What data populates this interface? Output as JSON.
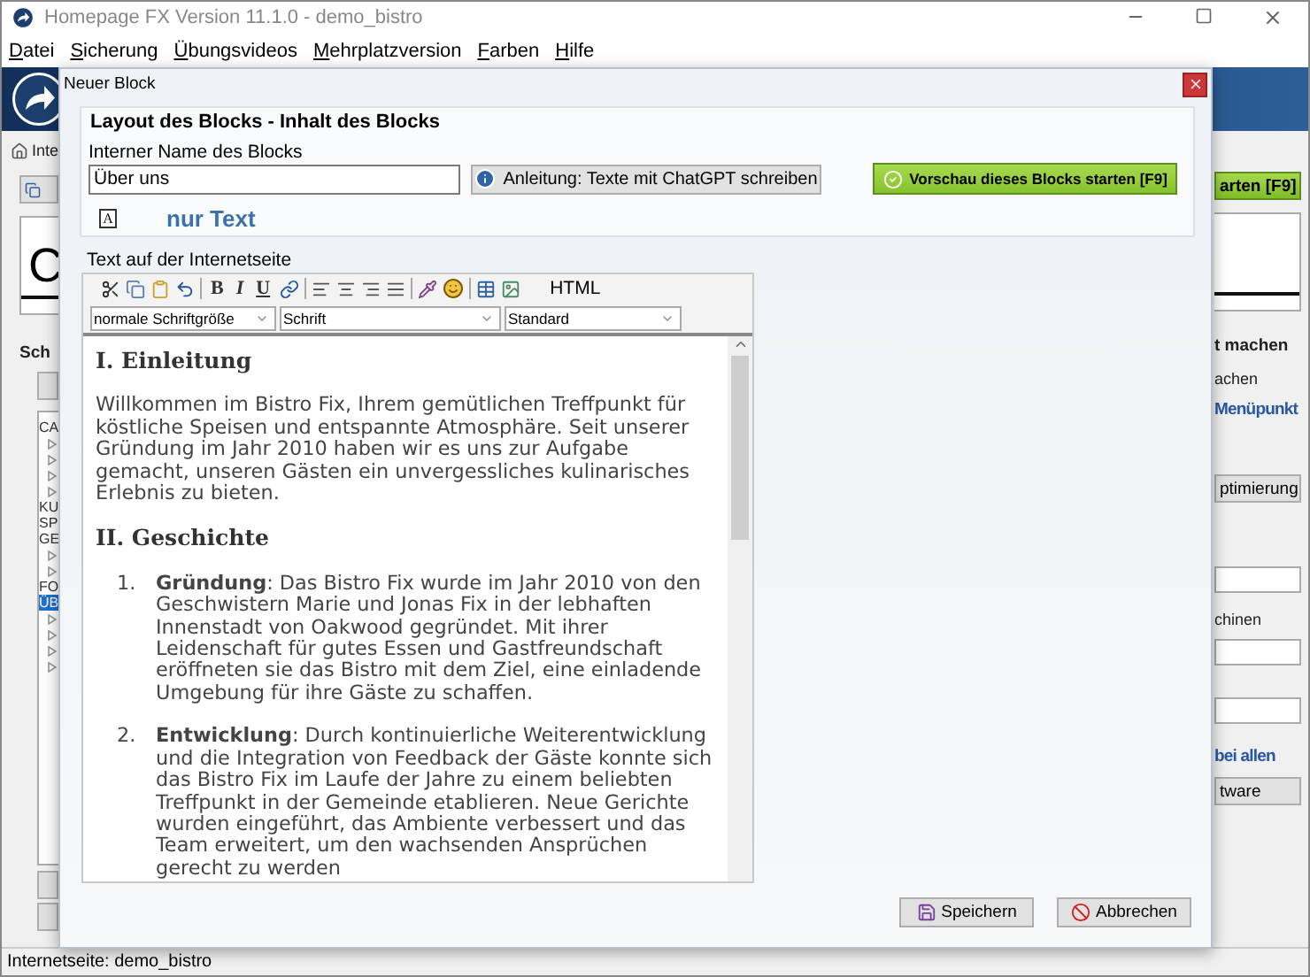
{
  "window": {
    "title": "Homepage FX Version 11.1.0 - demo_bistro"
  },
  "menu": [
    "Datei",
    "Sicherung",
    "Übungsvideos",
    "Mehrplatzversion",
    "Farben",
    "Hilfe"
  ],
  "background": {
    "breadcrumb": "Inte",
    "preview_button": "arten [F9]",
    "title_preview": "C",
    "section_title": "Sch",
    "tree": [
      {
        "label": "CA",
        "selected": false,
        "children": [
          {
            "selected": false
          },
          {
            "selected": false
          },
          {
            "selected": false
          },
          {
            "selected": false
          }
        ]
      },
      {
        "label": "KU",
        "selected": false
      },
      {
        "label": "SP",
        "selected": false
      },
      {
        "label": "GE",
        "selected": false,
        "children": [
          {
            "selected": false
          },
          {
            "selected": false
          }
        ]
      },
      {
        "label": "FO",
        "selected": false
      },
      {
        "label": "ÜB",
        "selected": true,
        "children": [
          {
            "selected": false
          },
          {
            "selected": false
          },
          {
            "selected": false
          },
          {
            "selected": false
          }
        ]
      }
    ],
    "right_panel": {
      "heading": "t machen",
      "text_1": "achen",
      "link_1": "Menüpunkt",
      "button_1": "ptimierung",
      "text_2": "chinen",
      "link_2": "bei allen",
      "button_2": "tware"
    }
  },
  "dialog": {
    "title": "Neuer Block",
    "group_title": "Layout des Blocks - Inhalt des Blocks",
    "name_label": "Interner Name des Blocks",
    "name_value": "Über uns",
    "help_button": "Anleitung: Texte mit ChatGPT schreiben",
    "preview_button": "Vorschau dieses Blocks starten [F9]",
    "block_type_icon": "A",
    "block_type": "nur Text",
    "editor_label": "Text auf der Internetseite",
    "toolbar": {
      "bold": "B",
      "italic": "I",
      "underline": "U",
      "html": "HTML"
    },
    "dropdowns": [
      "normale Schriftgröße",
      "Schrift",
      "Standard"
    ],
    "content": [
      {
        "kind": "heading",
        "text": "I. Einleitung"
      },
      {
        "kind": "paragraph",
        "text": "Willkommen im Bistro Fix, Ihrem gemütlichen Treffpunkt für köstliche Speisen und entspannte Atmosphäre. Seit unserer Gründung im Jahr 2010 haben wir es uns zur Aufgabe gemacht, unseren Gästen ein unvergessliches kulinarisches Erlebnis zu bieten."
      },
      {
        "kind": "heading",
        "text": "II. Geschichte"
      },
      {
        "kind": "list",
        "items": [
          {
            "number": "1.",
            "text": "**Gründung**: Das Bistro Fix wurde im Jahr 2010 von den Geschwistern Marie und Jonas Fix in der lebhaften Innenstadt von Oakwood gegründet. Mit ihrer Leidenschaft für gutes Essen und Gastfreundschaft eröffneten sie das Bistro mit dem Ziel, eine einladende Umgebung für ihre Gäste zu schaffen."
          },
          {
            "number": "2.",
            "text": "**Entwicklung**: Durch kontinuierliche Weiterentwicklung und die Integration von Feedback der Gäste konnte sich das Bistro Fix im Laufe der Jahre zu einem beliebten Treffpunkt in der Gemeinde etablieren. Neue Gerichte wurden eingeführt, das Ambiente verbessert und das Team erweitert, um den wachsenden Ansprüchen gerecht zu werden"
          }
        ]
      }
    ],
    "buttons": [
      {
        "kind": "save",
        "label": "Speichern"
      },
      {
        "kind": "cancel",
        "label": "Abbrechen"
      }
    ]
  },
  "status_bar": "Internetseite: demo_bistro"
}
